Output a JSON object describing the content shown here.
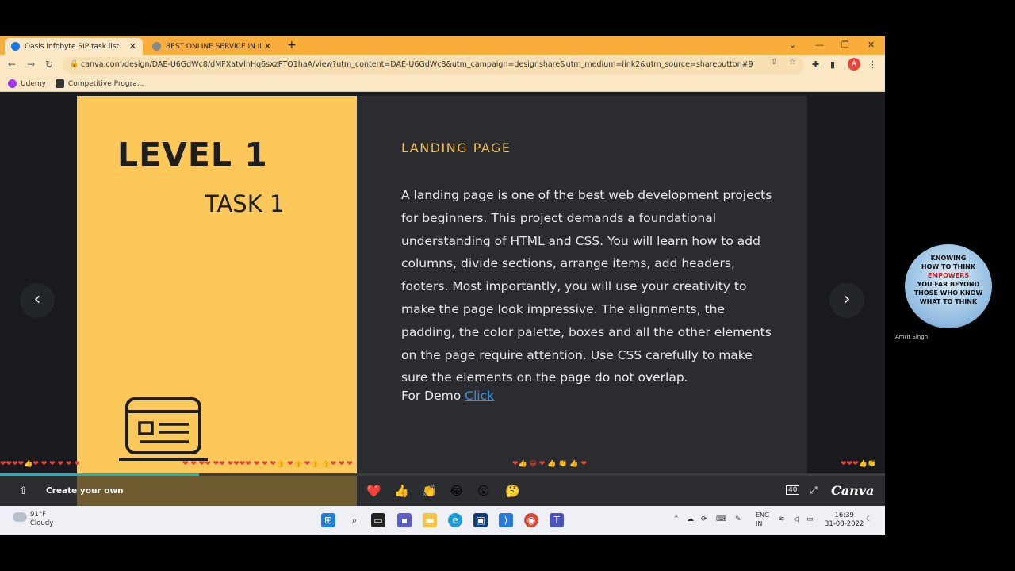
{
  "browser": {
    "tabs": [
      {
        "title": "Oasis Infobyte SIP task list",
        "active": true,
        "favicon_color": "#1a73e8"
      },
      {
        "title": "BEST ONLINE SERVICE IN INDIA",
        "active": false,
        "favicon_color": "#888888"
      }
    ],
    "url": "canva.com/design/DAE-U6GdWc8/dMFXatVlhHq6sxzPTO1haA/view?utm_content=DAE-U6GdWc8&utm_campaign=designshare&utm_medium=link2&utm_source=sharebutton#9",
    "bookmarks": [
      "Udemy",
      "Competitive Progra..."
    ],
    "profile_initial": "A"
  },
  "slide": {
    "level": "LEVEL 1",
    "task": "TASK 1",
    "section_title": "LANDING PAGE",
    "body": "A landing page is one of the best web development projects for beginners. This project demands a foundational understanding of HTML and CSS. You will learn how to add columns, divide sections, arrange items, add headers, footers. Most importantly, you will use your creativity to make the page look impressive. The alignments, the padding, the color palette, boxes and all the other elements on the page require attention. Use CSS carefully to make sure the elements on the page do not overlap.",
    "demo_label": "For Demo",
    "demo_link": "Click"
  },
  "viewer": {
    "progress": 0.225,
    "create_label": "Create your own",
    "reactions": [
      "❤️",
      "👍",
      "👏",
      "😂",
      "😮",
      "🤔"
    ],
    "brand": "Canva",
    "page_badge": "40"
  },
  "taskbar": {
    "weather_temp": "91°F",
    "weather_desc": "Cloudy",
    "lang_top": "ENG",
    "lang_bottom": "IN",
    "time": "16:39",
    "date": "31-08-2022"
  },
  "participant": {
    "name": "Amrit Singh",
    "poster_lines": [
      "KNOWING",
      "HOW TO THINK",
      "EMPOWERS",
      "YOU FAR BEYOND",
      "THOSE WHO KNOW",
      "WHAT TO THINK"
    ]
  },
  "colors": {
    "accent_yellow": "#fdc85a",
    "title_gold": "#f2c14e",
    "link_blue": "#3a8ee6",
    "progress_teal": "#18b2c4"
  }
}
